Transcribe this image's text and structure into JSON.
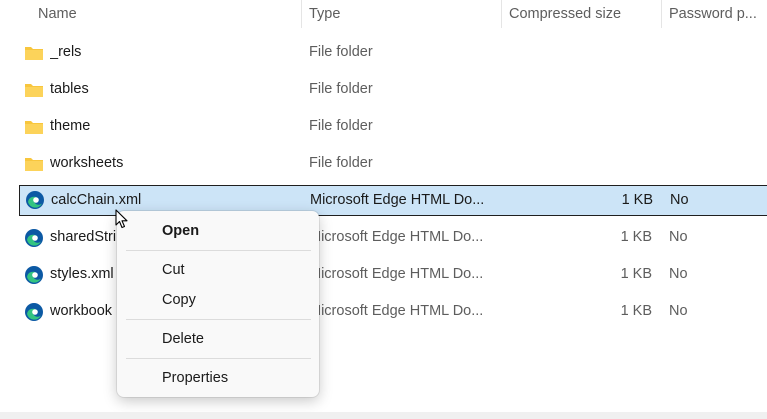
{
  "columns": {
    "name": "Name",
    "type": "Type",
    "size": "Compressed size",
    "password": "Password p..."
  },
  "files": [
    {
      "name": "_rels",
      "type": "File folder",
      "size": "",
      "password": "",
      "icon": "folder-icon"
    },
    {
      "name": "tables",
      "type": "File folder",
      "size": "",
      "password": "",
      "icon": "folder-icon"
    },
    {
      "name": "theme",
      "type": "File folder",
      "size": "",
      "password": "",
      "icon": "folder-icon"
    },
    {
      "name": "worksheets",
      "type": "File folder",
      "size": "",
      "password": "",
      "icon": "folder-icon"
    },
    {
      "name": "calcChain.xml",
      "type": "Microsoft Edge HTML Do...",
      "size": "1 KB",
      "password": "No",
      "icon": "edge-icon",
      "selected": true
    },
    {
      "name": "sharedStri",
      "type": "Microsoft Edge HTML Do...",
      "size": "1 KB",
      "password": "No",
      "icon": "edge-icon"
    },
    {
      "name": "styles.xml",
      "type": "Microsoft Edge HTML Do...",
      "size": "1 KB",
      "password": "No",
      "icon": "edge-icon"
    },
    {
      "name": "workbook",
      "type": "Microsoft Edge HTML Do...",
      "size": "1 KB",
      "password": "No",
      "icon": "edge-icon"
    }
  ],
  "context_menu": {
    "open": "Open",
    "cut": "Cut",
    "copy": "Copy",
    "delete": "Delete",
    "properties": "Properties"
  },
  "colors": {
    "selection": "#cce4f7",
    "folder": "#f8c63d",
    "edge_blue": "#0c59a4",
    "edge_green": "#33c481"
  }
}
